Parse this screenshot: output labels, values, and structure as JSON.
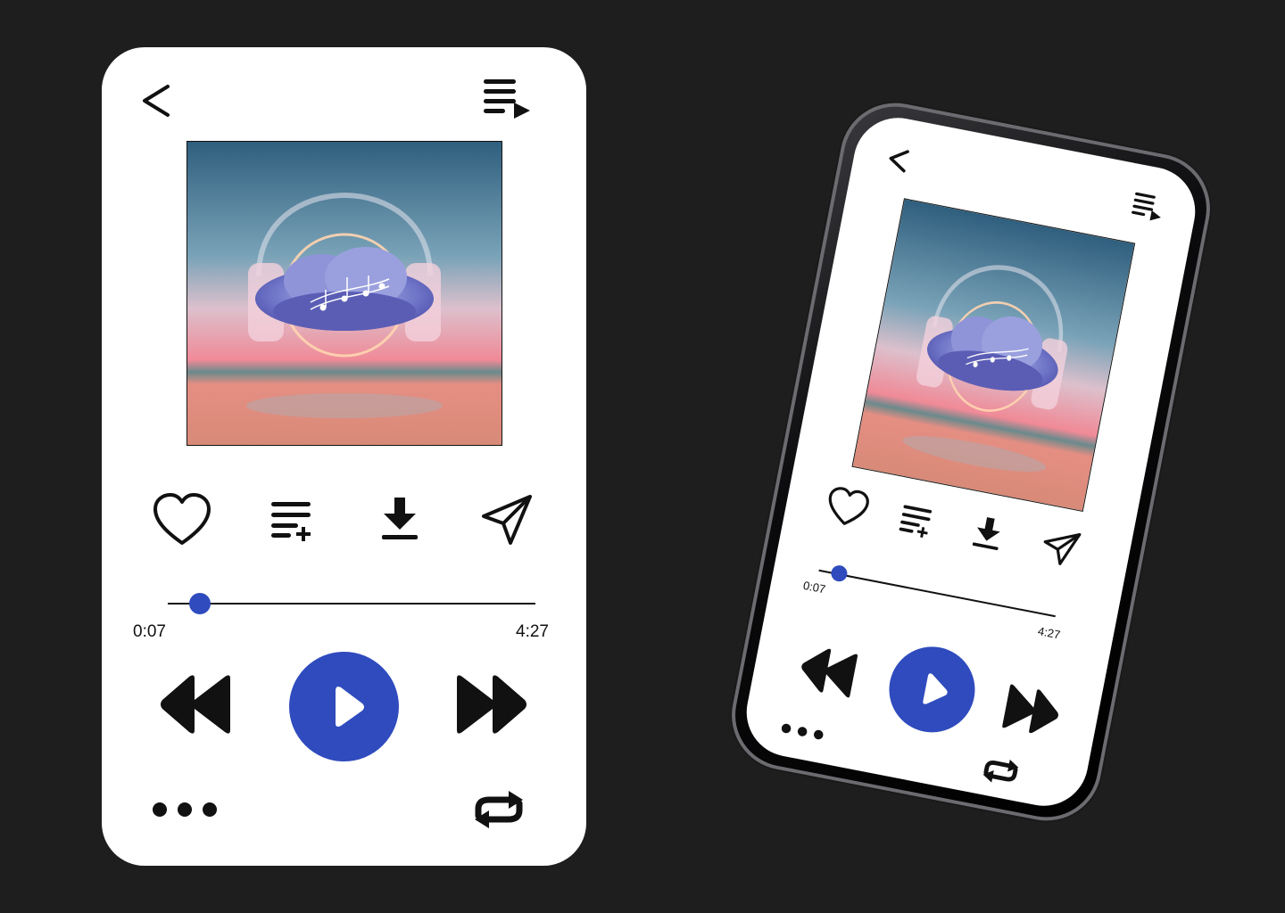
{
  "colors": {
    "background": "#1e1e1e",
    "card": "#ffffff",
    "accent": "#2f4bbd",
    "ink": "#111111"
  },
  "player": {
    "elapsed": "0:07",
    "duration": "4:27",
    "progress_fraction": 0.027
  },
  "icons": {
    "back": "back-chevron-icon",
    "queue": "queue-list-icon",
    "like": "heart-icon",
    "add_to_playlist": "playlist-add-icon",
    "download": "download-icon",
    "share": "send-icon",
    "rewind": "rewind-icon",
    "play": "play-icon",
    "forward": "fast-forward-icon",
    "more": "more-dots-icon",
    "repeat": "repeat-icon"
  },
  "phone": {
    "elapsed": "0:07",
    "duration": "4:27"
  }
}
